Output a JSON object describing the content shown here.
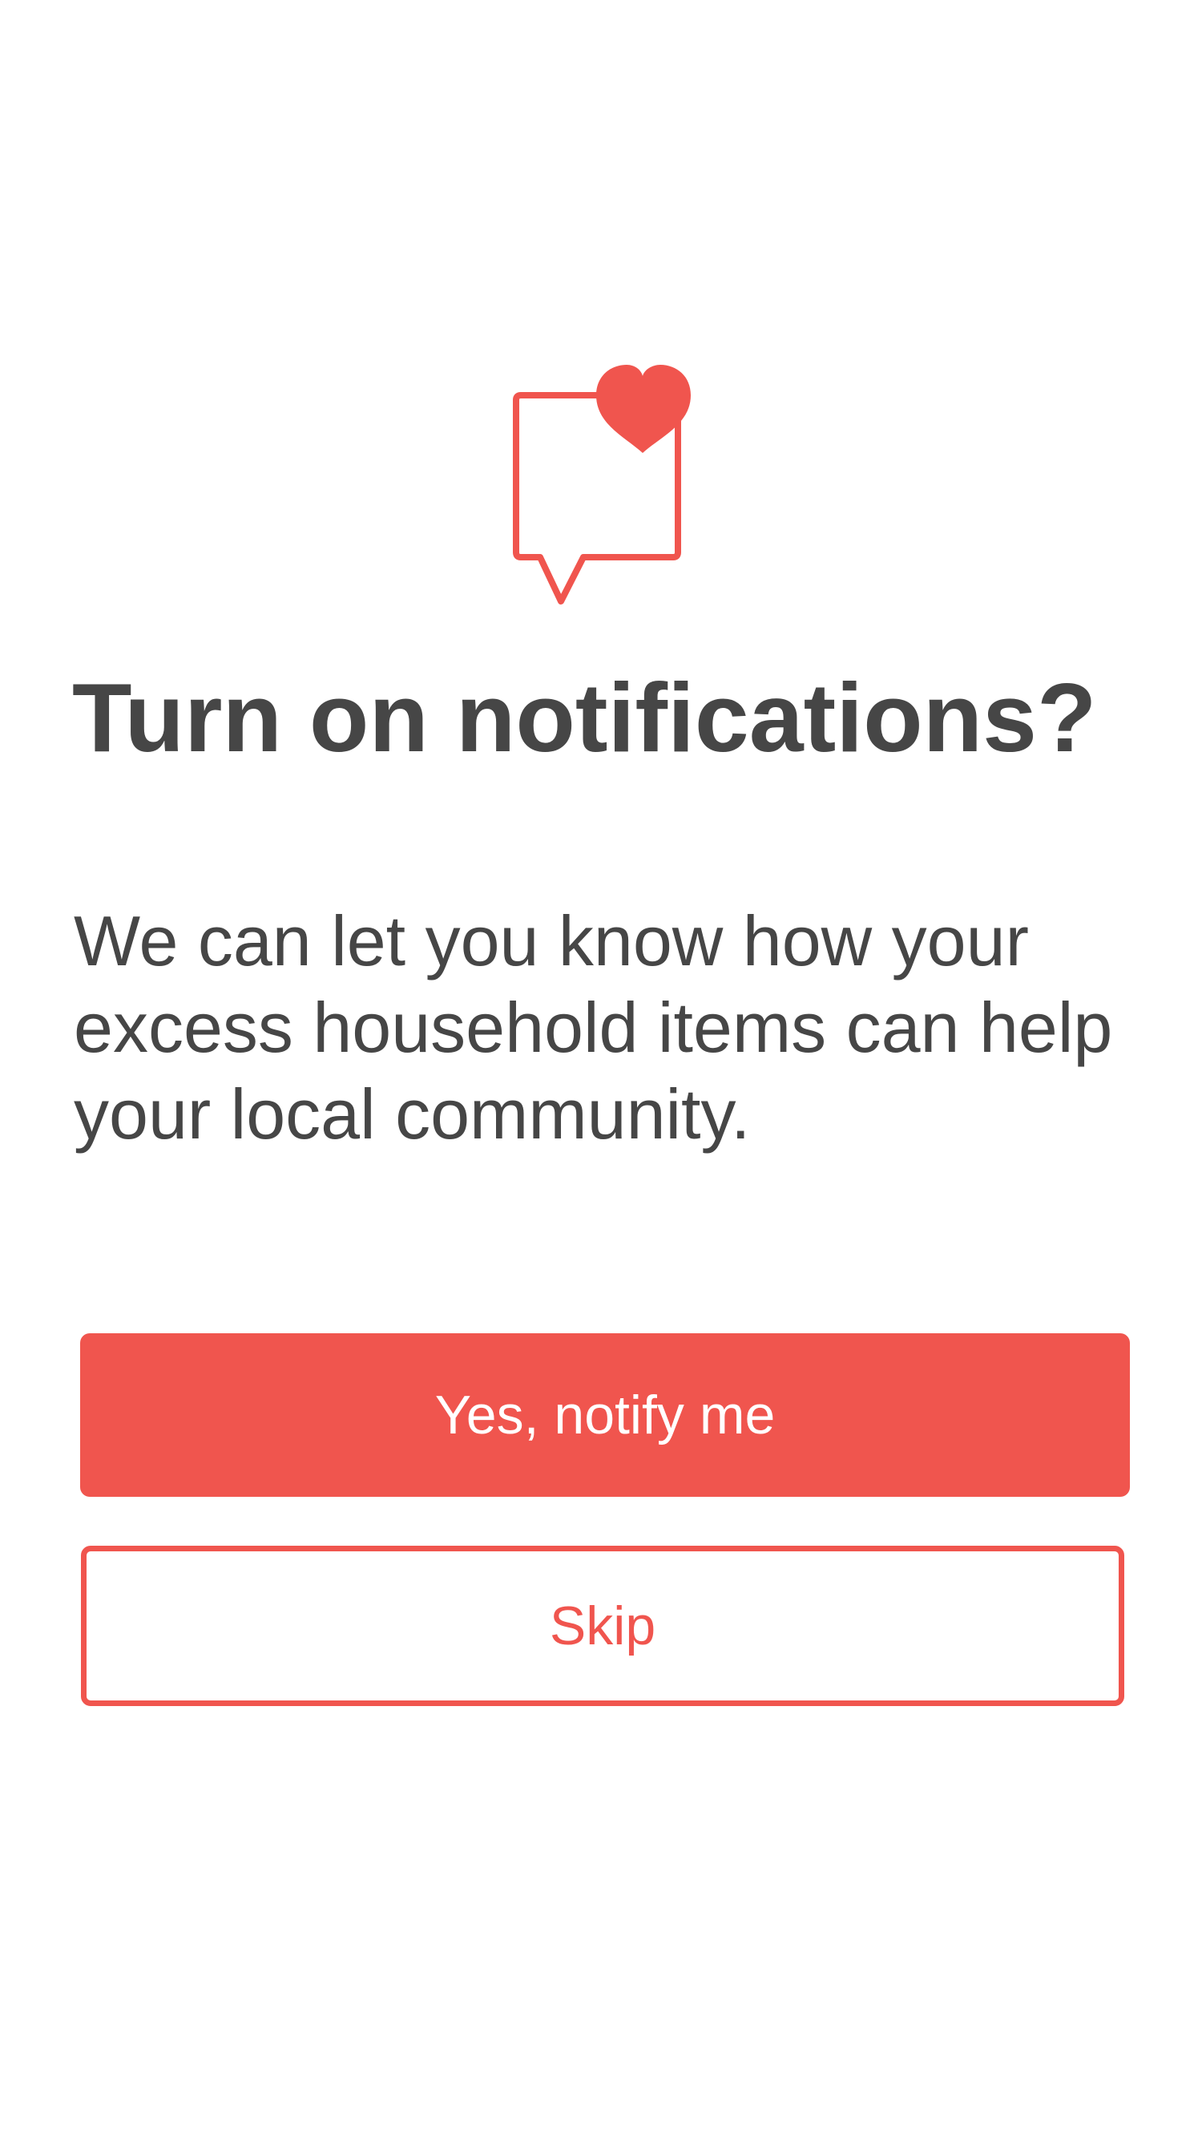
{
  "screen": {
    "title": "Turn on notifications?",
    "description": "We can let you know how your excess household items can help your local community.",
    "icon": "speech-bubble-heart-icon",
    "accent_color": "#f0554e",
    "text_color": "#464646"
  },
  "actions": {
    "primary_label": "Yes, notify me",
    "secondary_label": "Skip"
  }
}
